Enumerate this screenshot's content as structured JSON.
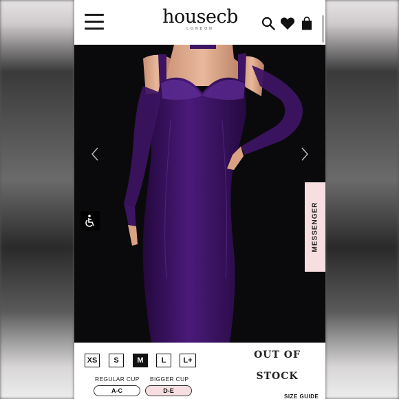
{
  "colors": {
    "dress": "#3d1463",
    "accent_pink": "#f7dfe1",
    "product_bg": "#0a0a0c"
  },
  "header": {
    "brand_name": "house of cb",
    "brand_logo_main": "housecb",
    "brand_logo_of": "of",
    "brand_sub": "LONDON",
    "icons": [
      "menu-icon",
      "search-icon",
      "heart-icon",
      "bag-icon"
    ]
  },
  "gallery": {
    "prev_icon": "chevron-left-icon",
    "next_icon": "chevron-right-icon",
    "accessibility_icon": "wheelchair-icon",
    "messenger_label": "MESSENGER"
  },
  "sizes": {
    "options": [
      "XS",
      "S",
      "M",
      "L",
      "L+"
    ],
    "selected": "M"
  },
  "cups": {
    "regular_label": "REGULAR CUP",
    "bigger_label": "BIGGER CUP",
    "regular_option": "A-C",
    "bigger_option": "D-E",
    "selected": "D-E"
  },
  "stock": {
    "line1": "OUT OF",
    "line2": "STOCK"
  },
  "size_guide_label": "SIZE GUIDE"
}
